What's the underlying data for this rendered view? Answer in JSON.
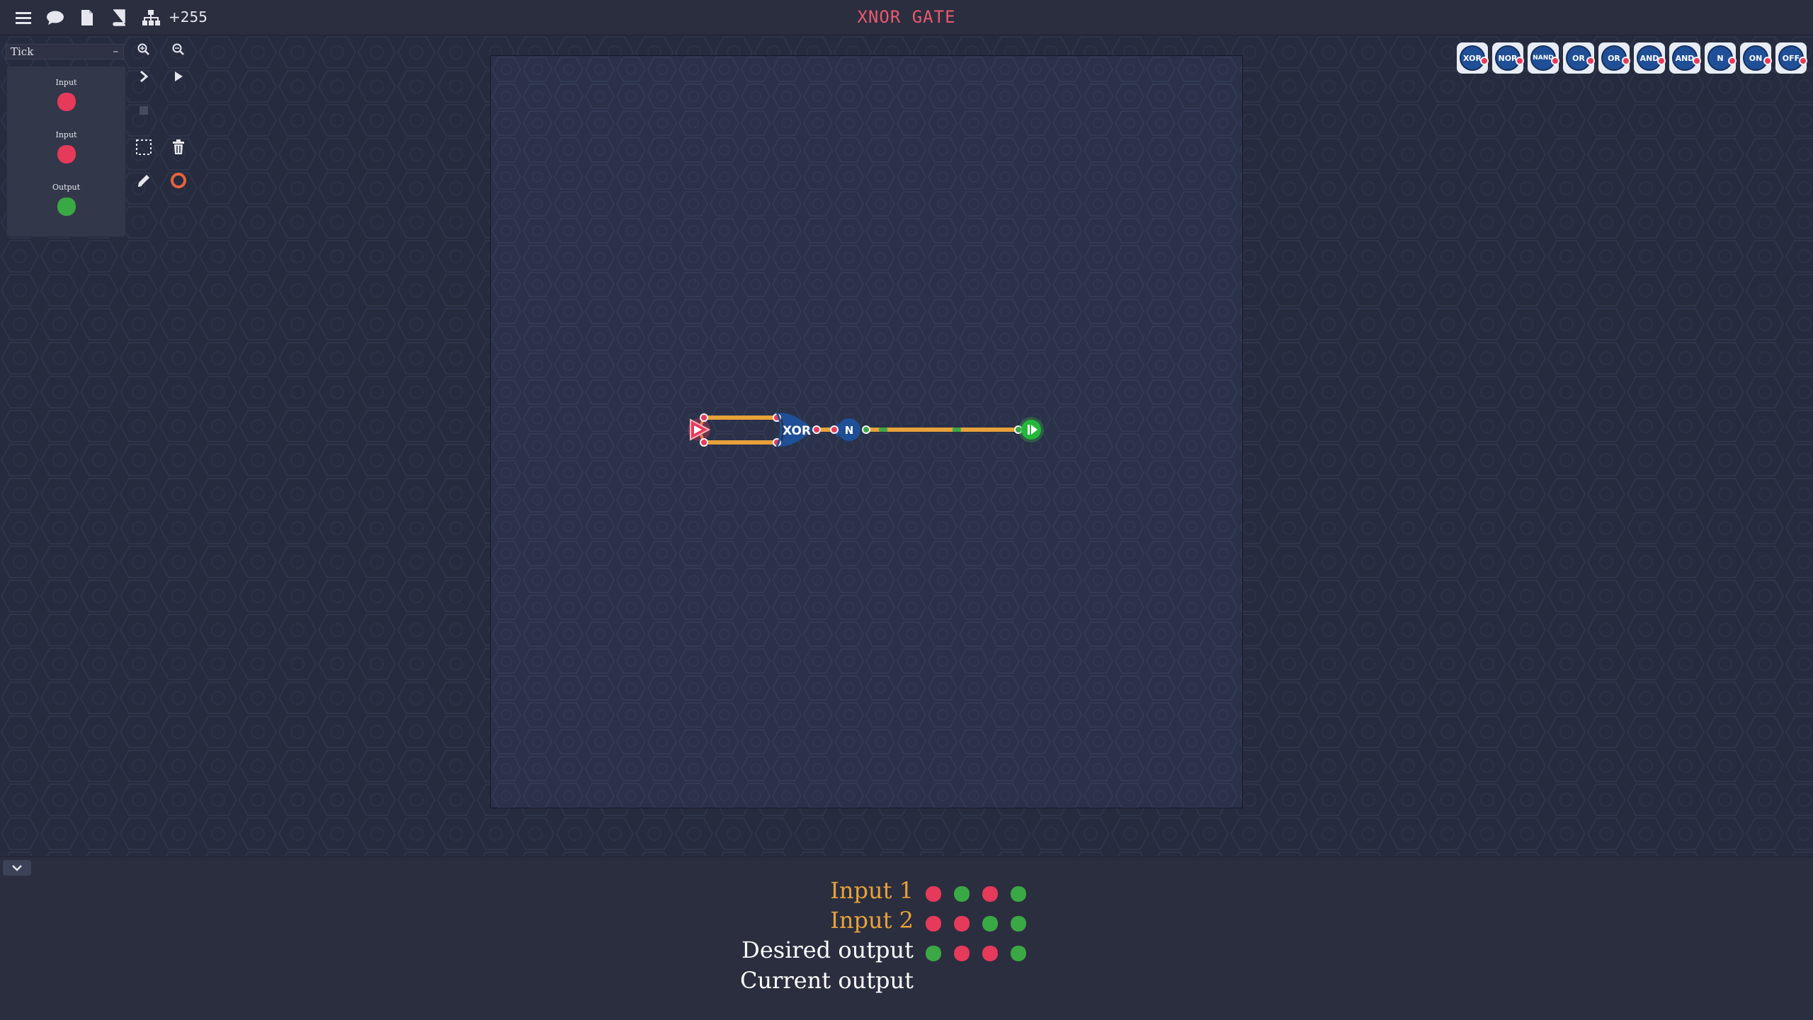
{
  "topbar": {
    "icons": [
      "menu-icon",
      "chat-icon",
      "file-icon",
      "book-icon",
      "hierarchy-icon"
    ],
    "count": "+255",
    "title": "XNOR GATE"
  },
  "left_panel": {
    "tick_select": "Tick",
    "tick_dash": "–",
    "io_items": [
      {
        "label": "Input",
        "state": "off"
      },
      {
        "label": "Input",
        "state": "off"
      },
      {
        "label": "Output",
        "state": "on"
      }
    ]
  },
  "board": {
    "gates": [
      {
        "type": "input",
        "label": ""
      },
      {
        "type": "xor",
        "label": "XOR"
      },
      {
        "type": "not",
        "label": "N"
      },
      {
        "type": "output",
        "label": ""
      }
    ]
  },
  "palette": [
    {
      "label": "XOR"
    },
    {
      "label": "NOR"
    },
    {
      "label": "NAND"
    },
    {
      "label": "OR"
    },
    {
      "label": "OR"
    },
    {
      "label": "AND"
    },
    {
      "label": "AND"
    },
    {
      "label": "N"
    },
    {
      "label": "ON"
    },
    {
      "label": "OFF"
    }
  ],
  "truth_table": {
    "rows": [
      {
        "label": "Input 1",
        "color": "#e8a23a",
        "values": [
          0,
          1,
          0,
          1
        ]
      },
      {
        "label": "Input 2",
        "color": "#e8a23a",
        "values": [
          0,
          0,
          1,
          1
        ]
      },
      {
        "label": "Desired output",
        "color": "#ffffff",
        "values": [
          1,
          0,
          0,
          1
        ]
      },
      {
        "label": "Current output",
        "color": "#ffffff",
        "values": []
      }
    ]
  },
  "colors": {
    "on": "#3aa845",
    "off": "#e63a5a",
    "wire": "#e8a23a",
    "gate": "#1f4f96",
    "title": "#ea5a6f"
  }
}
